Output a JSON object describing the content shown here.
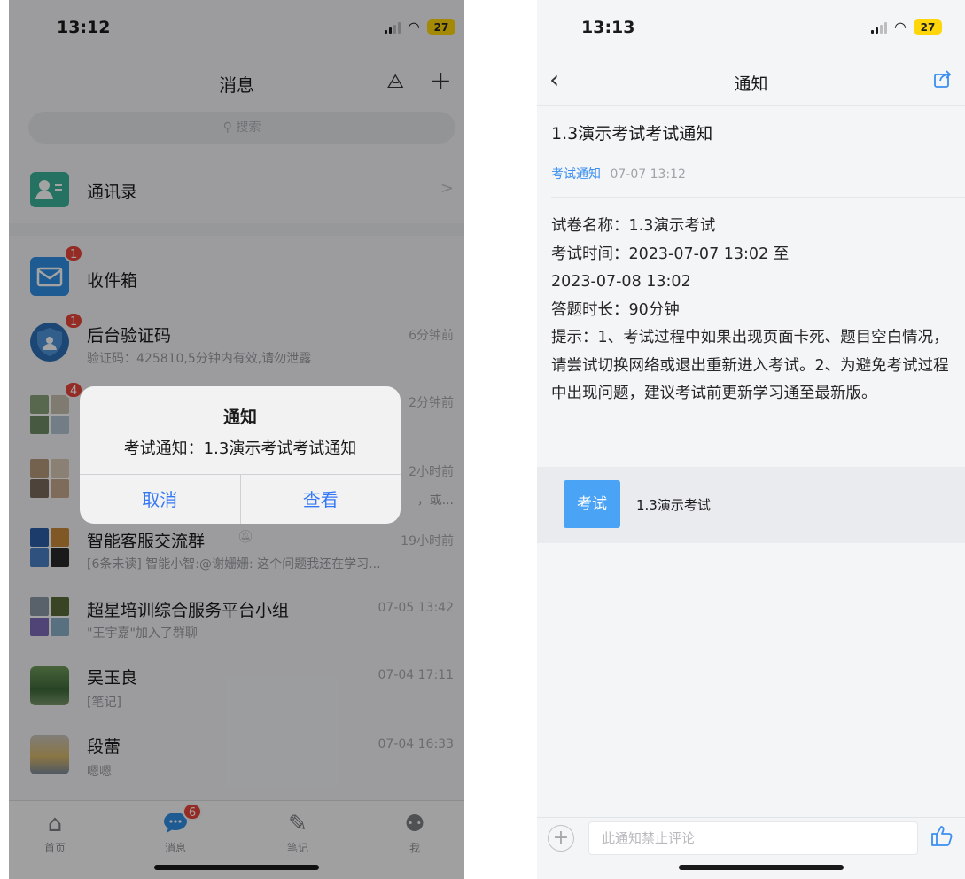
{
  "left": {
    "status": {
      "time": "13:12",
      "battery": "27"
    },
    "header": {
      "title": "消息"
    },
    "search": {
      "placeholder": "搜索"
    },
    "contacts": {
      "label": "通讯录"
    },
    "inbox": {
      "name": "收件箱",
      "badge": "1"
    },
    "conversations": [
      {
        "name": "后台验证码",
        "sub": "验证码：425810,5分钟内有效,请勿泄露",
        "time": "6分钟前",
        "badge": "1"
      },
      {
        "name": "",
        "sub": "",
        "time": "2分钟前",
        "badge": "4"
      },
      {
        "name": "",
        "sub": "，或...",
        "time": "2小时前",
        "badge": ""
      },
      {
        "name": "智能客服交流群",
        "sub": "[6条未读] 智能小智:@谢姗姗: 这个问题我还在学习...",
        "time": "19小时前",
        "badge": ""
      },
      {
        "name": "超星培训综合服务平台小组",
        "sub": "\"王宇嘉\"加入了群聊",
        "time": "07-05 13:42",
        "badge": ""
      },
      {
        "name": "吴玉良",
        "sub": "[笔记]",
        "time": "07-04 17:11",
        "badge": ""
      },
      {
        "name": "段蕾",
        "sub": "嗯嗯",
        "time": "07-04 16:33",
        "badge": ""
      }
    ],
    "dialog": {
      "title": "通知",
      "message": "考试通知：1.3演示考试考试通知",
      "cancel": "取消",
      "view": "查看"
    },
    "tabs": [
      {
        "label": "首页",
        "icon": "home-icon"
      },
      {
        "label": "消息",
        "icon": "chat-icon",
        "badge": "6"
      },
      {
        "label": "笔记",
        "icon": "note-icon"
      },
      {
        "label": "我",
        "icon": "person-icon"
      }
    ]
  },
  "right": {
    "status": {
      "time": "13:13",
      "battery": "27"
    },
    "header": {
      "title": "通知"
    },
    "notice": {
      "title": "1.3演示考试考试通知",
      "tag": "考试通知",
      "time": "07-07 13:12",
      "body": [
        "试卷名称：1.3演示考试",
        "考试时间：2023-07-07 13:02 至",
        "2023-07-08 13:02",
        "答题时长：90分钟",
        "提示：1、考试过程中如果出现页面卡死、题目空白情况，请尝试切换网络或退出重新进入考试。2、为避免考试过程中出现问题，建议考试前更新学习通至最新版。"
      ]
    },
    "exam_card": {
      "tag": "考试",
      "name": "1.3演示考试"
    },
    "comment": {
      "placeholder": "此通知禁止评论"
    }
  },
  "colors": {
    "accent": "#3478f6",
    "badge": "#e8443a",
    "exam_tag": "#4aa3f5",
    "battery": "#ffd60a"
  }
}
